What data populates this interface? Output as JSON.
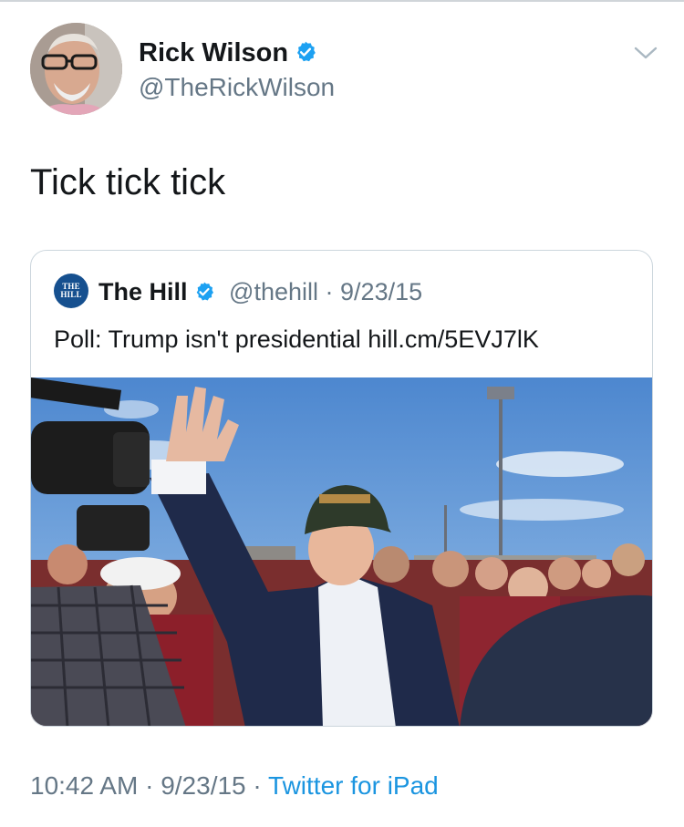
{
  "author": {
    "name": "Rick Wilson",
    "handle": "@TheRickWilson",
    "verified": true
  },
  "tweet": {
    "text": "Tick tick tick"
  },
  "quoted_tweet": {
    "logo_text": [
      "THE",
      "HILL"
    ],
    "name": "The Hill",
    "handle": "@thehill",
    "separator": "·",
    "date": "9/23/15",
    "text": "Poll: Trump isn't presidential hill.cm/5EVJ7lK"
  },
  "footer": {
    "time": "10:42 AM",
    "separator": "·",
    "date": "9/23/15",
    "source": "Twitter for iPad"
  },
  "icons": {
    "verified": "verified-badge-icon",
    "menu": "chevron-down-icon"
  },
  "colors": {
    "accent": "#1b95e0",
    "verified": "#1da1f2",
    "secondary_text": "#657786",
    "primary_text": "#14171a",
    "border": "#ccd6dd",
    "hill_logo": "#16508f"
  }
}
